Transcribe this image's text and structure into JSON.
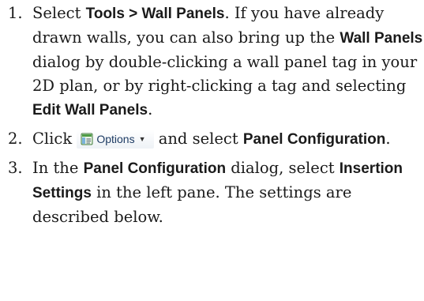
{
  "steps": [
    {
      "number": "1.",
      "t1": "Select ",
      "b1": "Tools > Wall Panels",
      "t2": ". If you have already drawn walls, you can also bring up the ",
      "b2": "Wall Panels",
      "t3": " dialog by double-clicking a wall panel tag in your 2D plan, or by right-clicking a tag and selecting ",
      "b3": "Edit Wall Panels",
      "t4": "."
    },
    {
      "number": "2.",
      "t1": "Click ",
      "button_label": "Options",
      "button_icon": "options-panel-icon",
      "t2": " and select ",
      "b1": "Panel Con­fig­uration",
      "t3": "."
    },
    {
      "number": "3.",
      "t1": "In the ",
      "b1": "Panel Configuration",
      "t2": " dialog, select ",
      "b2": "Insertion Settings",
      "t3": " in the left pane. The settings are described below."
    }
  ]
}
